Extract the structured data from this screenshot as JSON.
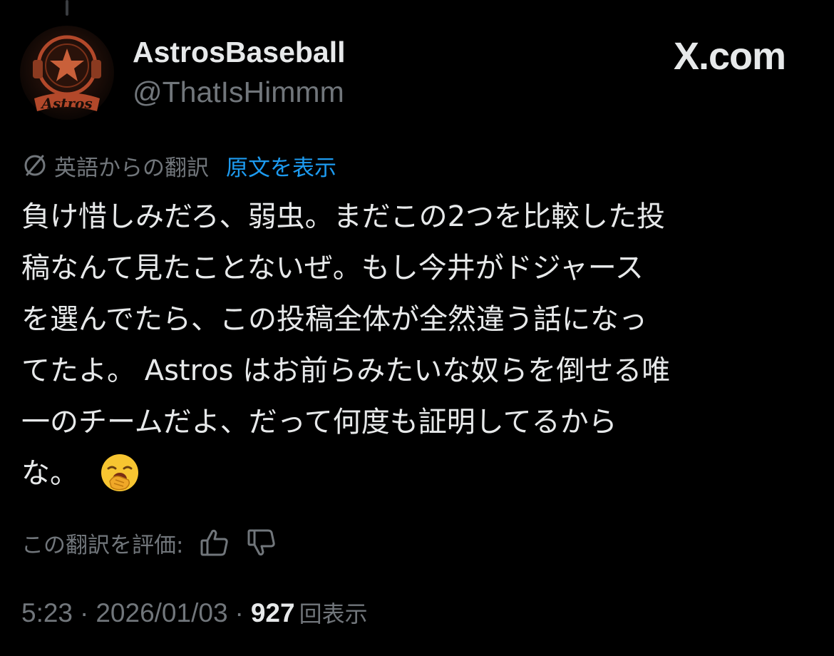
{
  "post": {
    "display_name": "AstrosBaseball",
    "handle": "@ThatIsHimmm",
    "site_mark": "X.com",
    "avatar": {
      "icon": "astros-helmet-logo",
      "text": "Astros",
      "colors": {
        "primary": "#c0502d",
        "background": "#1a0d08"
      }
    },
    "translation": {
      "icon": "translate-icon",
      "from_label": "英語からの翻訳",
      "show_original_label": "原文を表示"
    },
    "body_lines": [
      "負け惜しみだろ、弱虫。まだこの2つを比較した投",
      "稿なんて見たことないぜ。もし今井がドジャース",
      "を選んでたら、この投稿全体が全然違う話になっ",
      "てたよ。 Astros はお前らみたいな奴らを倒せる唯",
      "一のチームだよ、だって何度も証明してるから",
      "な。"
    ],
    "emoji": "yawning-face",
    "rate": {
      "label": "この翻訳を評価:",
      "up_icon": "thumbs-up-icon",
      "down_icon": "thumbs-down-icon"
    },
    "meta": {
      "time": "5:23",
      "separator": "·",
      "date": "2026/01/03",
      "views_count": "927",
      "views_label": "回表示"
    }
  },
  "colors": {
    "background": "#000000",
    "text": "#e7e9ea",
    "secondary_text": "#71767b",
    "link": "#1d9bf0"
  }
}
